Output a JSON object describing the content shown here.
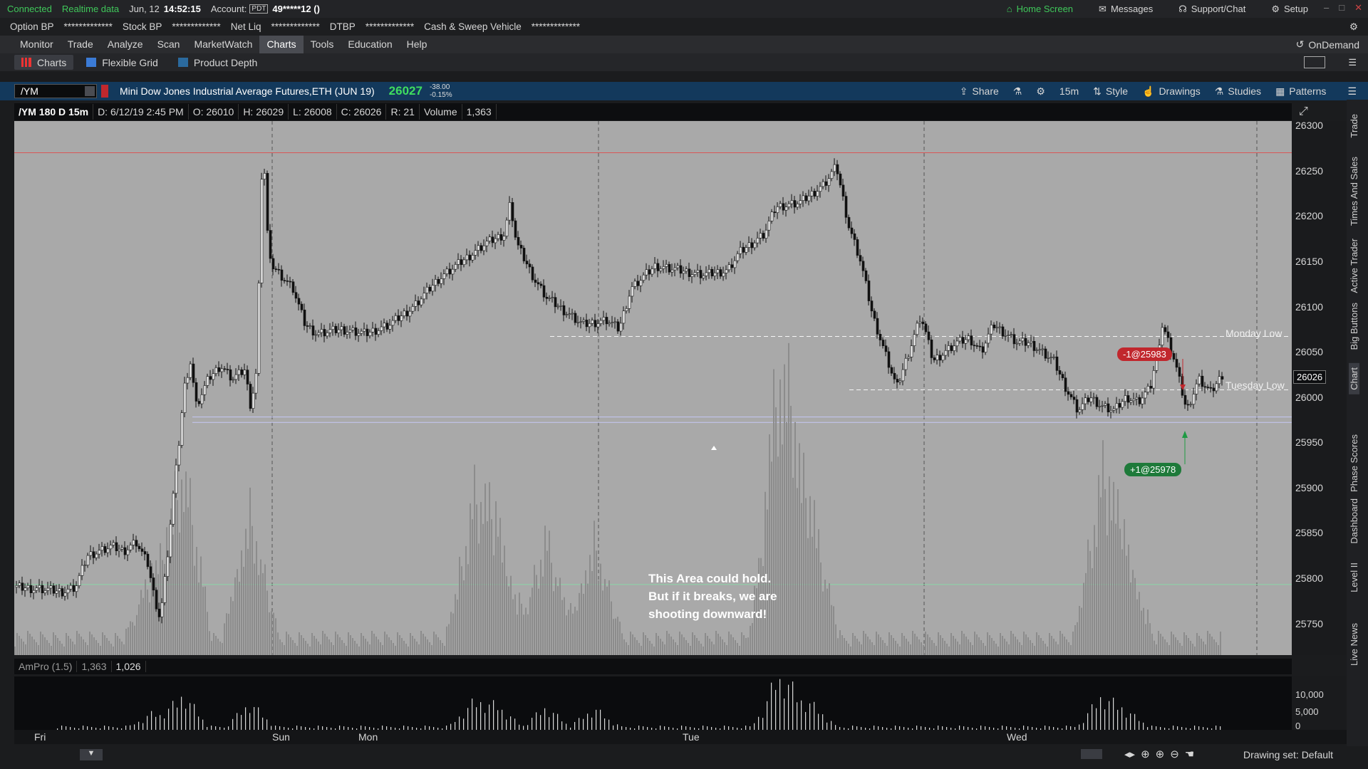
{
  "topbar": {
    "status": "Connected",
    "data_feed": "Realtime data",
    "date": "Jun, 12",
    "time": "14:52:15",
    "account_label": "Account:",
    "account_tag": "PDT",
    "account": "49*****12 ()",
    "home": "Home Screen",
    "messages": "Messages",
    "support": "Support/Chat",
    "setup": "Setup"
  },
  "bp": {
    "option_bp": "Option BP",
    "option_val": "*************",
    "stock_bp": "Stock BP",
    "stock_val": "*************",
    "netliq": "Net Liq",
    "netliq_val": "*************",
    "dtbp": "DTBP",
    "dtbp_val": "*************",
    "cash": "Cash & Sweep Vehicle",
    "cash_val": "*************"
  },
  "menu": [
    "Monitor",
    "Trade",
    "Analyze",
    "Scan",
    "MarketWatch",
    "Charts",
    "Tools",
    "Education",
    "Help"
  ],
  "menu_active": "Charts",
  "ondemand": "OnDemand",
  "sub": {
    "charts": "Charts",
    "flex": "Flexible Grid",
    "depth": "Product Depth"
  },
  "chart_header": {
    "symbol": "/YM",
    "desc": "Mini Dow Jones Industrial Average Futures,ETH (JUN 19)",
    "price": "26027",
    "chg": "-38.00",
    "pct": "-0.15%",
    "share": "Share",
    "tf": "15m",
    "style": "Style",
    "drawings": "Drawings",
    "studies": "Studies",
    "patterns": "Patterns"
  },
  "info": {
    "label": "/YM 180 D 15m",
    "d": "D: 6/12/19 2:45 PM",
    "o": "O: 26010",
    "h": "H: 26029",
    "l": "L: 26008",
    "c": "C: 26026",
    "r": "R: 21",
    "vol_label": "Volume",
    "vol": "1,363"
  },
  "annotation": {
    "line1": "This Area could hold.",
    "line2": "But if it breaks, we are",
    "line3": "shooting downward!"
  },
  "levels": {
    "monday": "Monday Low",
    "tuesday": "Tuesday Low",
    "current": "26026"
  },
  "orders": {
    "sell": "-1@25983",
    "buy": "+1@25978"
  },
  "volume_panel": {
    "label": "AmPro (1.5)",
    "v1": "1,363",
    "v2": "1,026"
  },
  "lower_axis": [
    "10,000",
    "5,000",
    "0"
  ],
  "xaxis": [
    "Fri",
    "Sun",
    "Mon",
    "Tue",
    "Wed"
  ],
  "drawing_set": "Drawing set: Default",
  "vtabs": [
    "Trade",
    "Times And Sales",
    "Active Trader",
    "Big Buttons",
    "Chart",
    "Phase Scores",
    "Dashboard",
    "Level II",
    "Live News"
  ],
  "vtabs_active": "Chart",
  "chart_data": {
    "type": "candlestick",
    "title": "/YM 180 D 15m",
    "y_ticks": [
      26300,
      26250,
      26200,
      26150,
      26100,
      26050,
      26000,
      25950,
      25900,
      25850,
      25800,
      25750
    ],
    "ylim": [
      25715,
      26305
    ],
    "x_labels": [
      "Fri",
      "Sun",
      "Mon",
      "Tue",
      "Wed"
    ],
    "price_path": [
      [
        0,
        25790
      ],
      [
        0.02,
        25788
      ],
      [
        0.04,
        25785
      ],
      [
        0.05,
        25790
      ],
      [
        0.06,
        25825
      ],
      [
        0.08,
        25835
      ],
      [
        0.09,
        25830
      ],
      [
        0.1,
        25840
      ],
      [
        0.11,
        25815
      ],
      [
        0.115,
        25780
      ],
      [
        0.12,
        25755
      ],
      [
        0.125,
        25810
      ],
      [
        0.13,
        25880
      ],
      [
        0.135,
        25940
      ],
      [
        0.14,
        26010
      ],
      [
        0.145,
        26040
      ],
      [
        0.15,
        25990
      ],
      [
        0.16,
        26020
      ],
      [
        0.17,
        26035
      ],
      [
        0.18,
        26020
      ],
      [
        0.19,
        26030
      ],
      [
        0.195,
        25990
      ],
      [
        0.2,
        26030
      ],
      [
        0.205,
        26290
      ],
      [
        0.21,
        26150
      ],
      [
        0.23,
        26120
      ],
      [
        0.24,
        26080
      ],
      [
        0.25,
        26070
      ],
      [
        0.27,
        26075
      ],
      [
        0.29,
        26070
      ],
      [
        0.31,
        26080
      ],
      [
        0.33,
        26100
      ],
      [
        0.35,
        26130
      ],
      [
        0.37,
        26150
      ],
      [
        0.39,
        26170
      ],
      [
        0.405,
        26180
      ],
      [
        0.41,
        26215
      ],
      [
        0.415,
        26170
      ],
      [
        0.43,
        26130
      ],
      [
        0.44,
        26110
      ],
      [
        0.46,
        26090
      ],
      [
        0.47,
        26080
      ],
      [
        0.49,
        26085
      ],
      [
        0.5,
        26075
      ],
      [
        0.51,
        26120
      ],
      [
        0.53,
        26145
      ],
      [
        0.55,
        26140
      ],
      [
        0.57,
        26135
      ],
      [
        0.59,
        26140
      ],
      [
        0.6,
        26160
      ],
      [
        0.62,
        26180
      ],
      [
        0.63,
        26210
      ],
      [
        0.65,
        26215
      ],
      [
        0.67,
        26235
      ],
      [
        0.68,
        26255
      ],
      [
        0.69,
        26190
      ],
      [
        0.7,
        26150
      ],
      [
        0.71,
        26090
      ],
      [
        0.72,
        26050
      ],
      [
        0.73,
        26010
      ],
      [
        0.74,
        26050
      ],
      [
        0.75,
        26090
      ],
      [
        0.76,
        26040
      ],
      [
        0.77,
        26050
      ],
      [
        0.78,
        26060
      ],
      [
        0.79,
        26065
      ],
      [
        0.8,
        26050
      ],
      [
        0.81,
        26080
      ],
      [
        0.82,
        26070
      ],
      [
        0.83,
        26060
      ],
      [
        0.84,
        26060
      ],
      [
        0.85,
        26050
      ],
      [
        0.86,
        26040
      ],
      [
        0.87,
        26010
      ],
      [
        0.88,
        25985
      ],
      [
        0.89,
        26000
      ],
      [
        0.9,
        25990
      ],
      [
        0.91,
        25985
      ],
      [
        0.92,
        26000
      ],
      [
        0.93,
        25995
      ],
      [
        0.94,
        26010
      ],
      [
        0.95,
        26080
      ],
      [
        0.96,
        26040
      ],
      [
        0.97,
        25985
      ],
      [
        0.98,
        26020
      ],
      [
        0.99,
        26005
      ],
      [
        1.0,
        26026
      ]
    ],
    "volume_peaks": [
      [
        0.115,
        130
      ],
      [
        0.14,
        300
      ],
      [
        0.195,
        220
      ],
      [
        0.38,
        230
      ],
      [
        0.4,
        190
      ],
      [
        0.44,
        180
      ],
      [
        0.48,
        170
      ],
      [
        0.63,
        300
      ],
      [
        0.64,
        260
      ],
      [
        0.66,
        210
      ],
      [
        0.9,
        280
      ],
      [
        0.92,
        150
      ]
    ]
  }
}
